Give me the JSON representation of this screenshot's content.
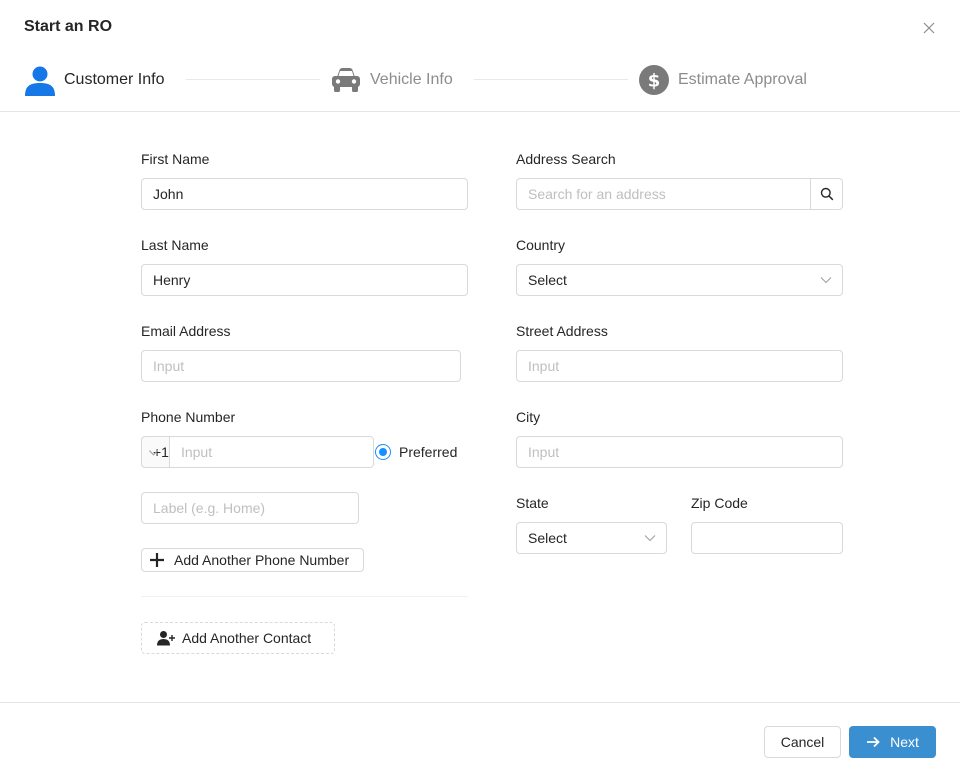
{
  "modal": {
    "title": "Start an RO"
  },
  "steps": [
    {
      "label": "Customer Info",
      "state": "active",
      "icon": "user-icon"
    },
    {
      "label": "Vehicle Info",
      "state": "inactive",
      "icon": "car-icon"
    },
    {
      "label": "Estimate Approval",
      "state": "inactive",
      "icon": "dollar-icon"
    }
  ],
  "form": {
    "first_name": {
      "label": "First Name",
      "value": "John"
    },
    "last_name": {
      "label": "Last Name",
      "value": "Henry"
    },
    "email": {
      "label": "Email Address",
      "placeholder": "Input"
    },
    "phone": {
      "label": "Phone Number",
      "country_code": "+1",
      "placeholder": "Input",
      "preferred_label": "Preferred",
      "label_placeholder": "Label (e.g. Home)"
    },
    "add_phone_label": "Add Another Phone Number",
    "add_contact_label": "Add Another Contact",
    "address_search": {
      "label": "Address Search",
      "placeholder": "Search for an address"
    },
    "country": {
      "label": "Country",
      "value": "Select"
    },
    "street": {
      "label": "Street Address",
      "placeholder": "Input"
    },
    "city": {
      "label": "City",
      "placeholder": "Input"
    },
    "state": {
      "label": "State",
      "value": "Select"
    },
    "zip": {
      "label": "Zip Code",
      "value": ""
    }
  },
  "footer": {
    "cancel_label": "Cancel",
    "next_label": "Next"
  },
  "colors": {
    "primary": "#3a8fd0",
    "active_step": "#1677e6",
    "inactive_step": "#7a7a7a",
    "radio": "#1890ff"
  }
}
